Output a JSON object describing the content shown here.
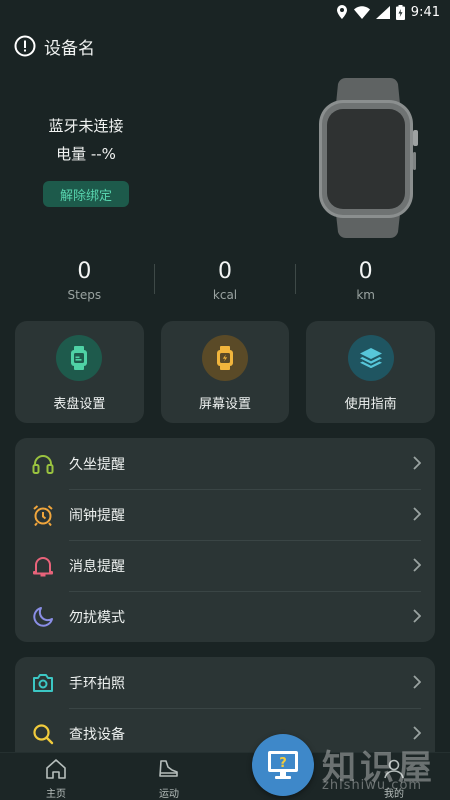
{
  "status_bar": {
    "time": "9:41"
  },
  "header": {
    "title": "设备名",
    "icon": "alert-circle-icon"
  },
  "device": {
    "bluetooth_status": "蓝牙未连接",
    "battery": "电量 --%",
    "unbind_label": "解除绑定",
    "image": "smartwatch"
  },
  "stats": [
    {
      "value": "0",
      "unit": "Steps"
    },
    {
      "value": "0",
      "unit": "kcal"
    },
    {
      "value": "0",
      "unit": "km"
    }
  ],
  "quick_actions": [
    {
      "label": "表盘设置",
      "icon": "watch-face-icon",
      "color": "#4fd1a5",
      "bg": "#1e5a4c"
    },
    {
      "label": "屏幕设置",
      "icon": "watch-screen-icon",
      "color": "#f1b53c",
      "bg": "#5a4a27"
    },
    {
      "label": "使用指南",
      "icon": "layers-icon",
      "color": "#57c6d9",
      "bg": "#1f5561"
    }
  ],
  "reminders": [
    {
      "label": "久坐提醒",
      "icon": "headset-icon",
      "color": "#9ac33f"
    },
    {
      "label": "闹钟提醒",
      "icon": "alarm-clock-icon",
      "color": "#f1a63c"
    },
    {
      "label": "消息提醒",
      "icon": "bell-icon",
      "color": "#e8637a"
    },
    {
      "label": "勿扰模式",
      "icon": "moon-icon",
      "color": "#8a8ee6"
    }
  ],
  "tools": [
    {
      "label": "手环拍照",
      "icon": "camera-icon",
      "color": "#3cc7c4"
    },
    {
      "label": "查找设备",
      "icon": "search-icon",
      "color": "#f1cb3c"
    }
  ],
  "bottom_nav": [
    {
      "label": "主页",
      "icon": "home-icon"
    },
    {
      "label": "运动",
      "icon": "shoe-icon"
    },
    {
      "label": "我的",
      "icon": "user-icon"
    }
  ],
  "overlay": {
    "help_icon": "help-monitor-icon",
    "watermark": "知识屋",
    "watermark_url": "zhishiwu.com"
  }
}
